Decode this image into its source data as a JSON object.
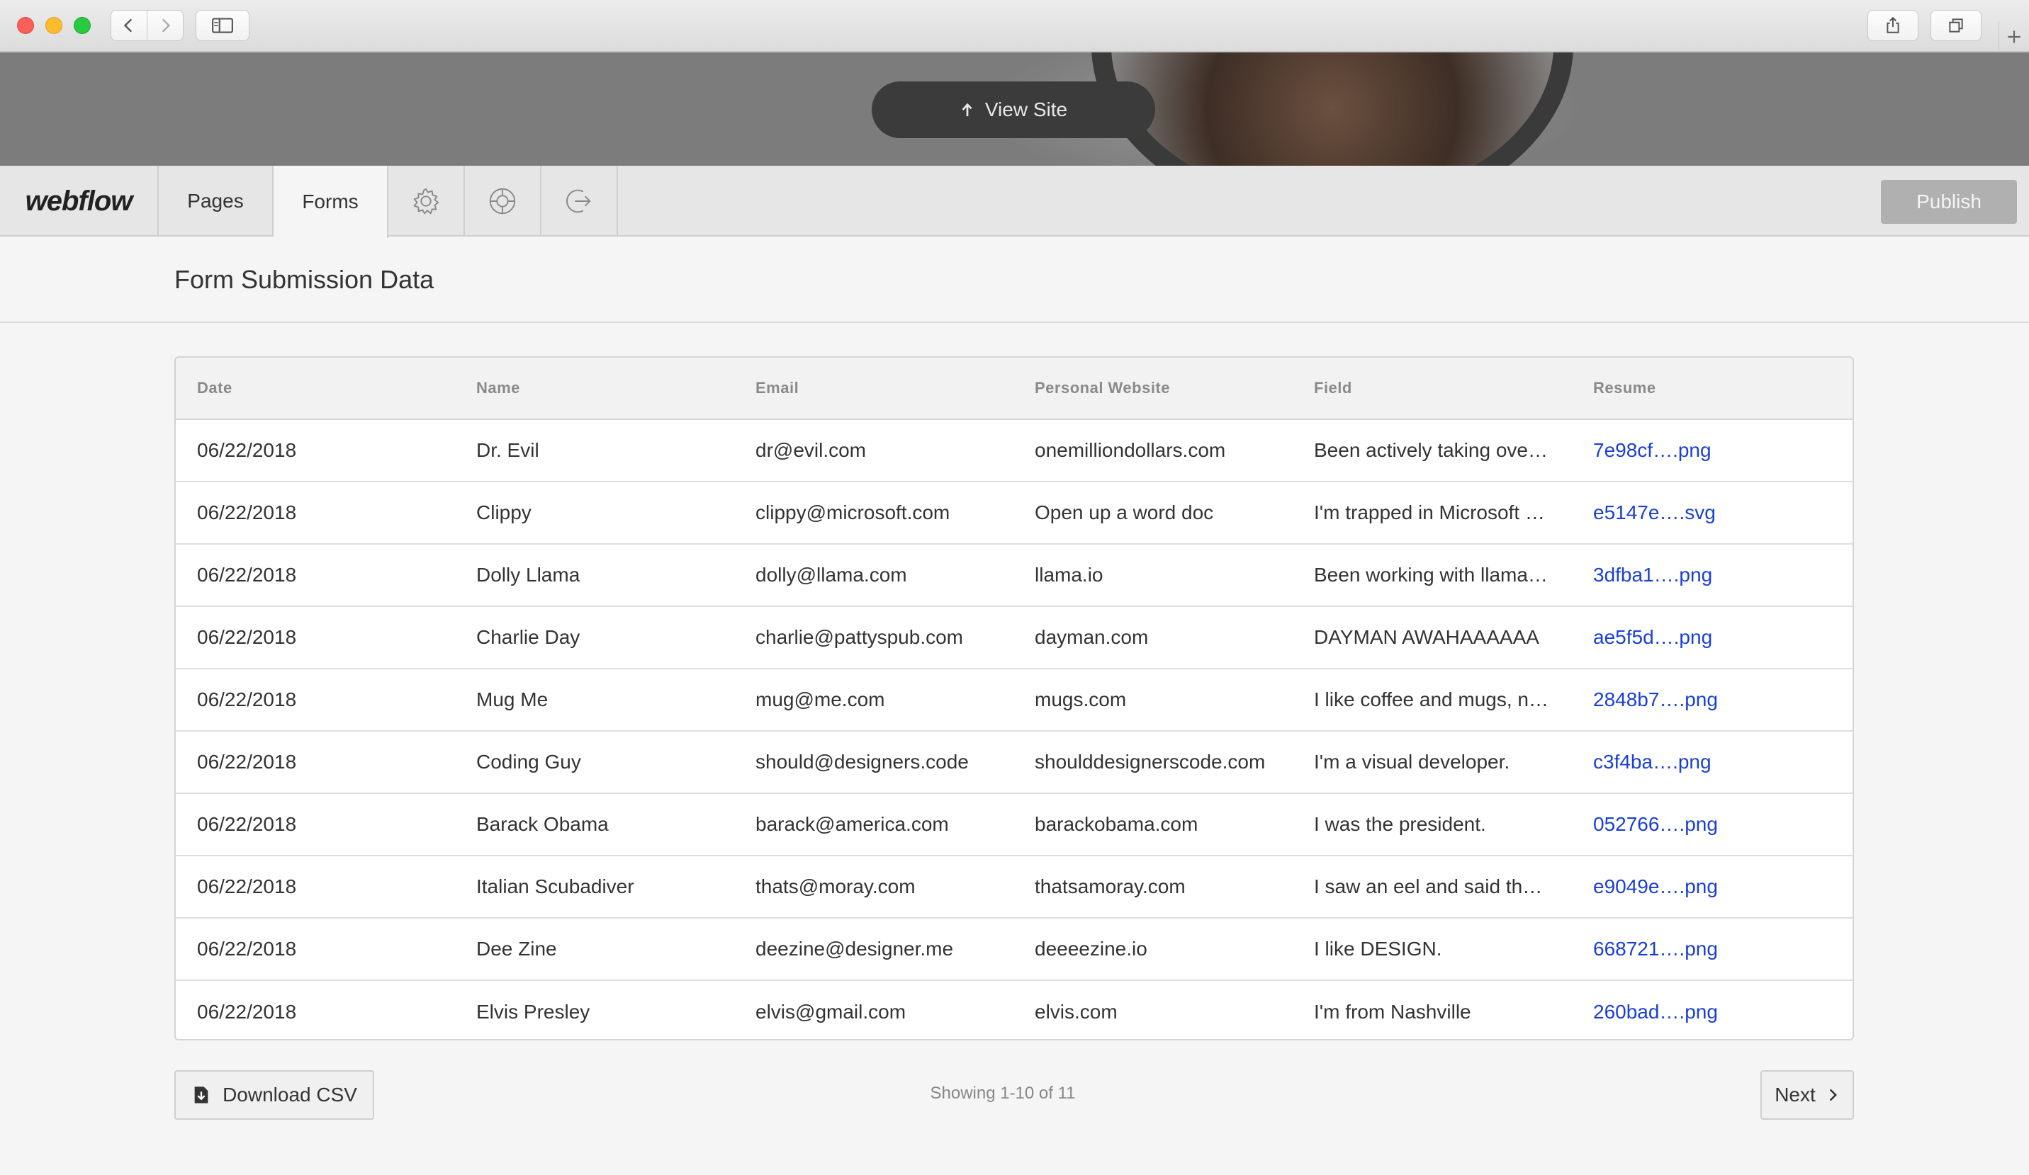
{
  "hero": {
    "view_site_label": "View Site"
  },
  "toolbar": {
    "logo": "webflow",
    "tabs": [
      {
        "label": "Pages"
      },
      {
        "label": "Forms"
      }
    ],
    "icons": [
      "gear-icon",
      "lifebuoy-icon",
      "export-icon"
    ],
    "publish_label": "Publish"
  },
  "page": {
    "title": "Form Submission Data"
  },
  "table": {
    "columns": [
      "Date",
      "Name",
      "Email",
      "Personal Website",
      "Field",
      "Resume"
    ],
    "rows": [
      [
        "06/22/2018",
        "Dr. Evil",
        "dr@evil.com",
        "onemilliondollars.com",
        "Been actively taking ove…",
        "7e98cf….png"
      ],
      [
        "06/22/2018",
        "Clippy",
        "clippy@microsoft.com",
        "Open up a word doc",
        "I'm trapped in Microsoft …",
        "e5147e….svg"
      ],
      [
        "06/22/2018",
        "Dolly Llama",
        "dolly@llama.com",
        "llama.io",
        "Been working with llama…",
        "3dfba1….png"
      ],
      [
        "06/22/2018",
        "Charlie Day",
        "charlie@pattyspub.com",
        "dayman.com",
        "DAYMAN AWAHAAAAAA",
        "ae5f5d….png"
      ],
      [
        "06/22/2018",
        "Mug Me",
        "mug@me.com",
        "mugs.com",
        "I like coffee and mugs, n…",
        "2848b7….png"
      ],
      [
        "06/22/2018",
        "Coding Guy",
        "should@designers.code",
        "shoulddesignerscode.com",
        "I'm a visual developer.",
        "c3f4ba….png"
      ],
      [
        "06/22/2018",
        "Barack Obama",
        "barack@america.com",
        "barackobama.com",
        "I was the president.",
        "052766….png"
      ],
      [
        "06/22/2018",
        "Italian Scubadiver",
        "thats@moray.com",
        "thatsamoray.com",
        "I saw an eel and said th…",
        "e9049e….png"
      ],
      [
        "06/22/2018",
        "Dee Zine",
        "deezine@designer.me",
        "deeeezine.io",
        "I like DESIGN.",
        "668721….png"
      ],
      [
        "06/22/2018",
        "Elvis Presley",
        "elvis@gmail.com",
        "elvis.com",
        "I'm from Nashville",
        "260bad….png"
      ]
    ]
  },
  "footer": {
    "download_label": "Download CSV",
    "showing": "Showing 1-10 of 11",
    "next_label": "Next"
  },
  "colors": {
    "link": "#1a3fd6",
    "publish_bg": "#b0b0b0"
  }
}
